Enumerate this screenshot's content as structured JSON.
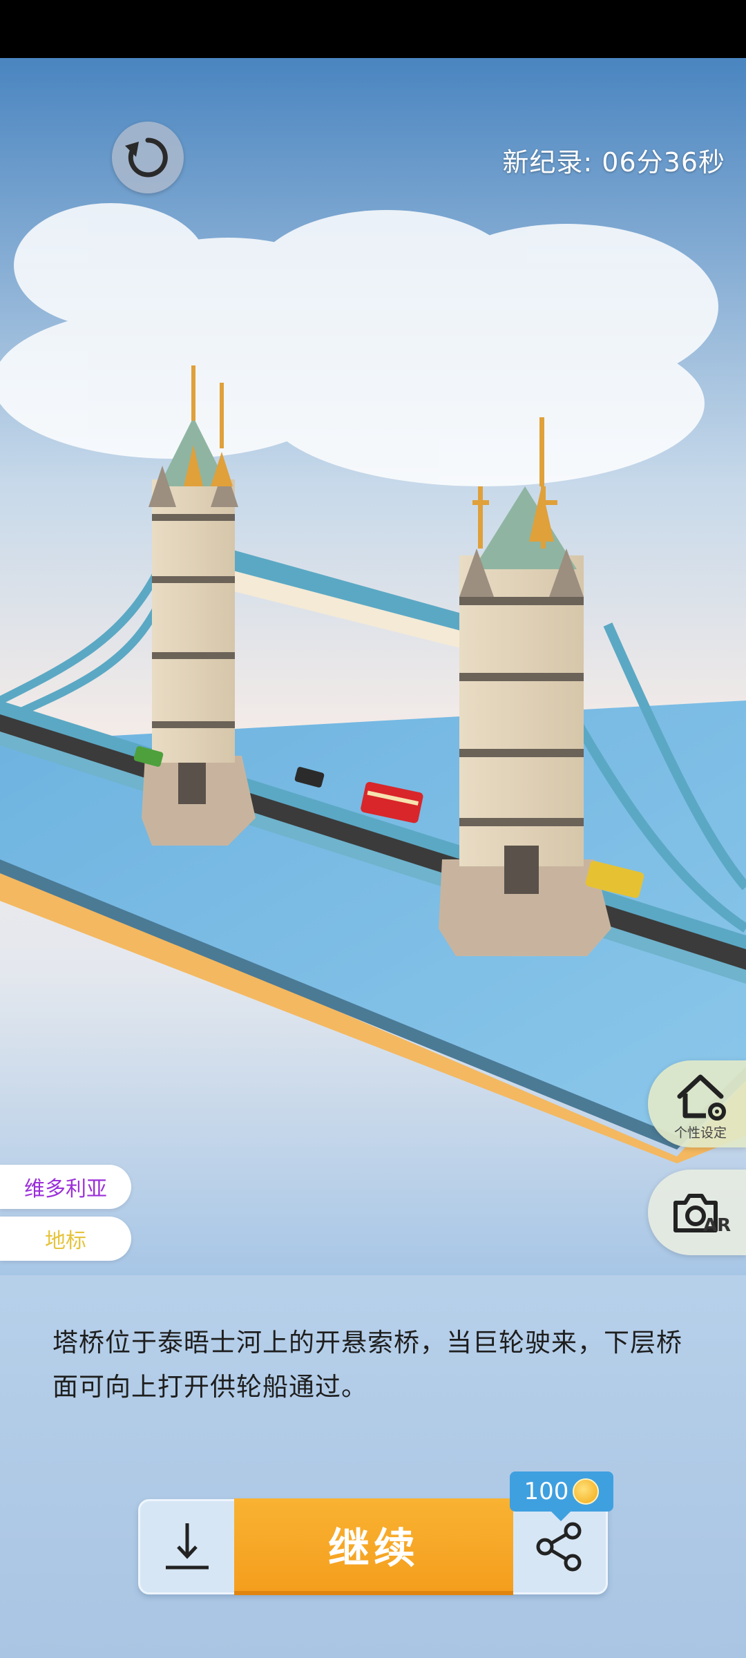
{
  "hud": {
    "record_text": "新纪录: 06分36秒"
  },
  "side_buttons": {
    "settings_label": "个性设定",
    "ar_label": "AR"
  },
  "tags": {
    "victoria": "维多利亚",
    "landmark": "地标"
  },
  "description": "塔桥位于泰晤士河上的开悬索桥，当巨轮驶来，下层桥面可向上打开供轮船通过。",
  "actions": {
    "continue_label": "继续",
    "coin_cost": "100"
  },
  "icons": {
    "reset": "refresh-icon",
    "settings": "house-gear-icon",
    "ar": "camera-icon",
    "download": "download-icon",
    "share": "share-icon",
    "coin": "coin-icon"
  },
  "colors": {
    "accent_orange": "#f7a826",
    "badge_blue": "#3fa0e0",
    "tag_purple": "#9b30d9",
    "tag_yellow": "#e5c43c"
  }
}
